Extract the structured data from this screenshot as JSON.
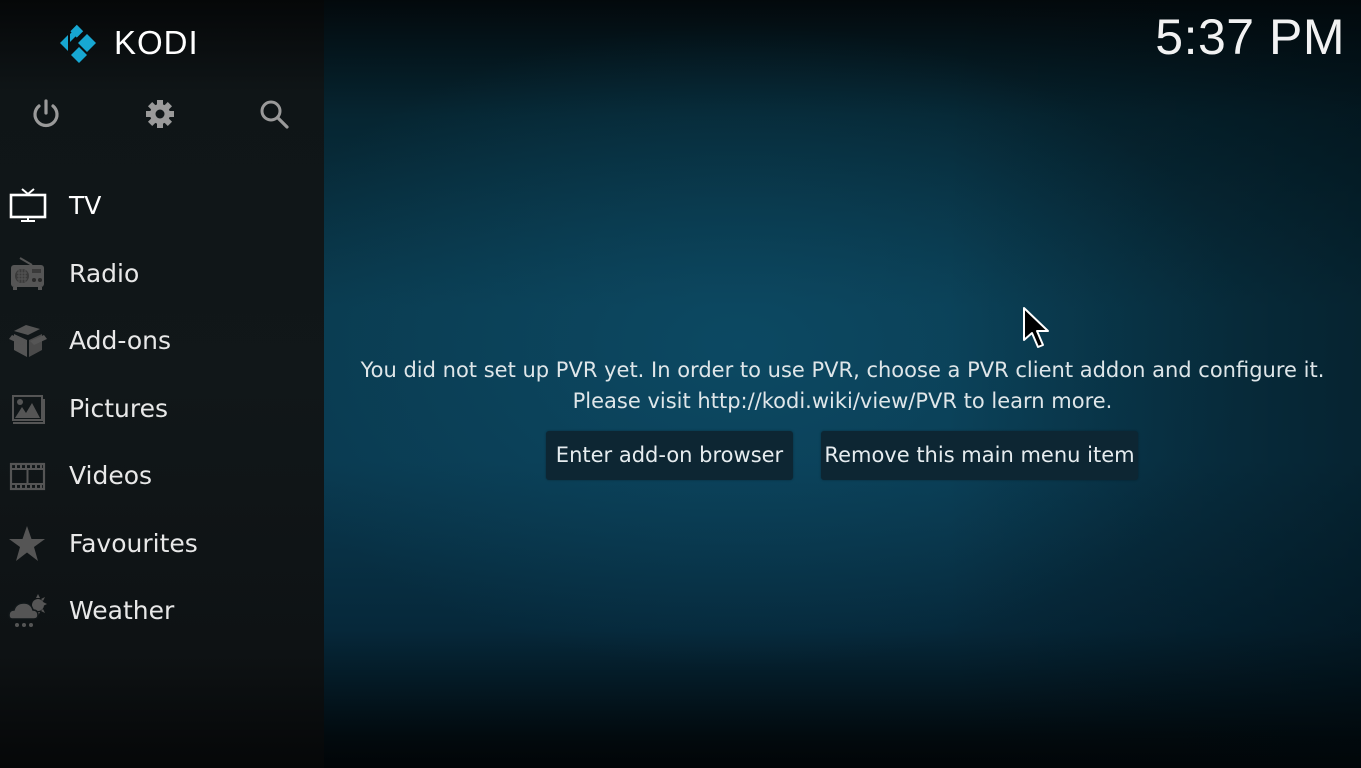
{
  "app": {
    "name": "KODI",
    "accent_color": "#17a7d2"
  },
  "header": {
    "clock": "5:37 PM"
  },
  "top_icons": [
    {
      "name": "power-icon",
      "label": "Power"
    },
    {
      "name": "gear-icon",
      "label": "Settings"
    },
    {
      "name": "search-icon",
      "label": "Search"
    }
  ],
  "menu": {
    "items": [
      {
        "id": "tv",
        "label": "TV",
        "icon": "tv-icon",
        "selected": true
      },
      {
        "id": "radio",
        "label": "Radio",
        "icon": "radio-icon"
      },
      {
        "id": "addons",
        "label": "Add-ons",
        "icon": "box-icon"
      },
      {
        "id": "pictures",
        "label": "Pictures",
        "icon": "pictures-icon"
      },
      {
        "id": "videos",
        "label": "Videos",
        "icon": "film-icon"
      },
      {
        "id": "favourites",
        "label": "Favourites",
        "icon": "star-icon"
      },
      {
        "id": "weather",
        "label": "Weather",
        "icon": "weather-icon"
      }
    ]
  },
  "content": {
    "message": "You did not set up PVR yet. In order to use PVR, choose a PVR client addon and configure it. Please visit http://kodi.wiki/view/PVR to learn more.",
    "buttons": {
      "addon_browser": "Enter add-on browser",
      "remove_item": "Remove this main menu item"
    }
  }
}
